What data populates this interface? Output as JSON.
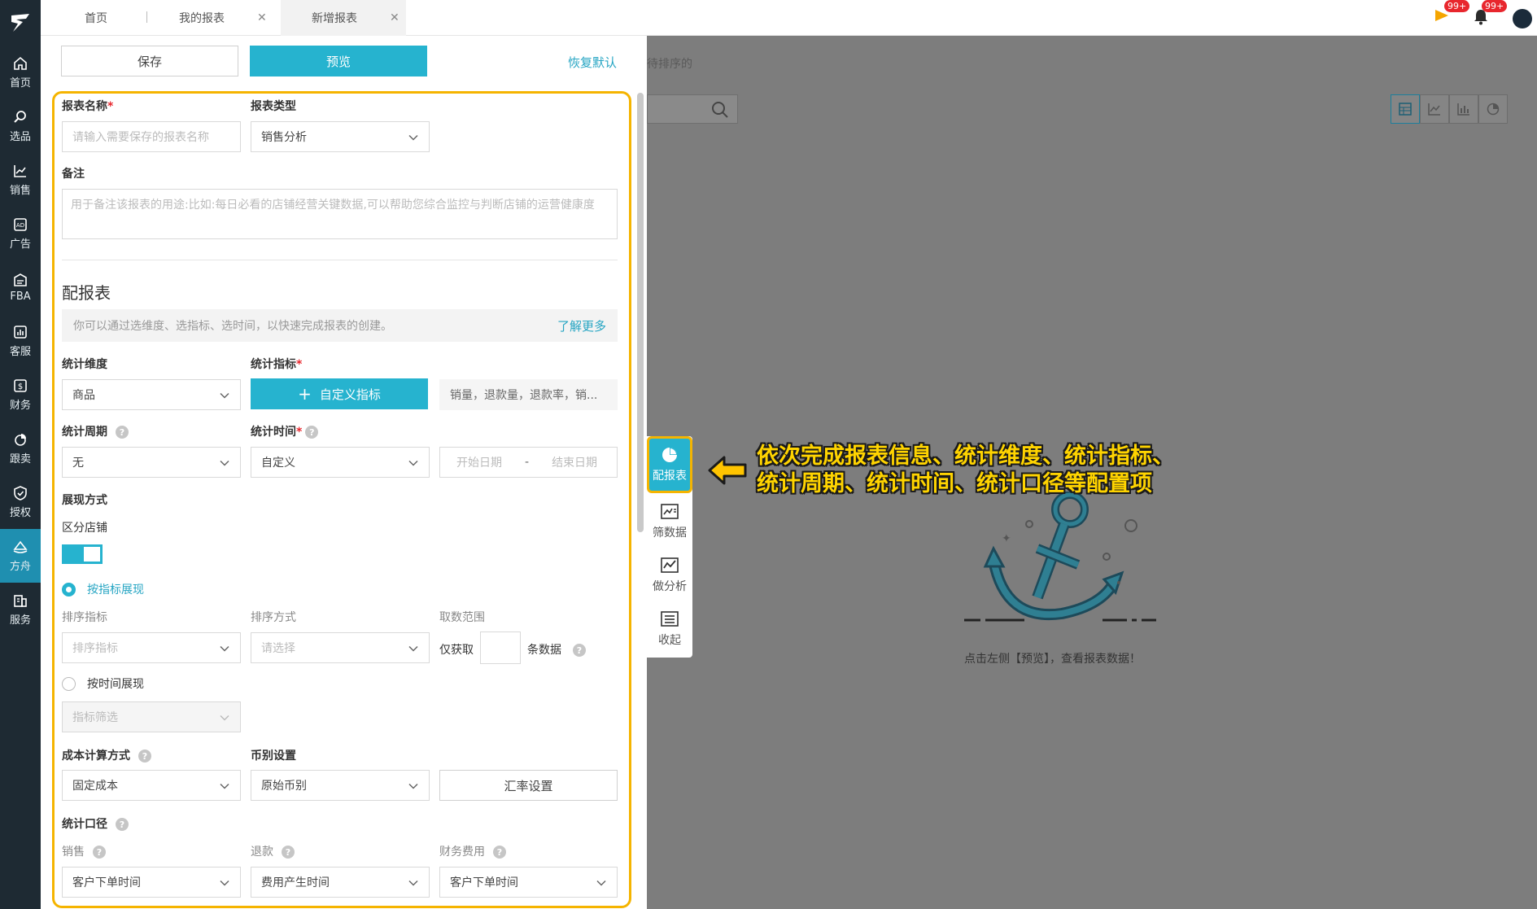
{
  "nav": {
    "items": [
      {
        "label": "首页",
        "icon": "home-icon"
      },
      {
        "label": "选品",
        "icon": "search-icon"
      },
      {
        "label": "销售",
        "icon": "chart-line-icon"
      },
      {
        "label": "广告",
        "icon": "ad-icon"
      },
      {
        "label": "FBA",
        "icon": "warehouse-icon"
      },
      {
        "label": "客服",
        "icon": "bar-chart-icon"
      },
      {
        "label": "财务",
        "icon": "dollar-icon"
      },
      {
        "label": "跟卖",
        "icon": "pie-icon"
      },
      {
        "label": "授权",
        "icon": "shield-icon"
      },
      {
        "label": "方舟",
        "icon": "ark-icon"
      },
      {
        "label": "服务",
        "icon": "building-icon"
      }
    ],
    "active": "方舟"
  },
  "tabs": [
    {
      "label": "首页"
    },
    {
      "label": "我的报表"
    },
    {
      "label": "新增报表"
    }
  ],
  "notifications": {
    "flag_count": "99+",
    "bell_count": "99+"
  },
  "toolbar": {
    "save": "保存",
    "preview": "预览",
    "reset": "恢复默认"
  },
  "background": {
    "sort_text": "待排序的",
    "empty_text": "点击左侧【预览】，查看报表数据！"
  },
  "form": {
    "report_name_label": "报表名称",
    "report_name_placeholder": "请输入需要保存的报表名称",
    "report_type_label": "报表类型",
    "report_type_value": "销售分析",
    "remark_label": "备注",
    "remark_placeholder": "用于备注该报表的用途:比如:每日必看的店铺经营关键数据,可以帮助您综合监控与判断店铺的运营健康度",
    "section_title": "配报表",
    "hint_text": "你可以通过选维度、选指标、选时间，以快速完成报表的创建。",
    "hint_more": "了解更多",
    "dimension_label": "统计维度",
    "dimension_value": "商品",
    "metric_label": "统计指标",
    "custom_metric_button": "自定义指标",
    "metric_summary": "销量，退款量，退款率，销...",
    "period_label": "统计周期",
    "period_value": "无",
    "time_label": "统计时间",
    "time_value": "自定义",
    "start_date": "开始日期",
    "date_sep": "-",
    "end_date": "结束日期",
    "display_label": "展现方式",
    "shop_split_label": "区分店铺",
    "by_metric_label": "按指标展现",
    "sort_metric_label": "排序指标",
    "sort_metric_placeholder": "排序指标",
    "sort_method_label": "排序方式",
    "sort_method_placeholder": "请选择",
    "range_label": "取数范围",
    "range_prefix": "仅获取",
    "range_suffix": "条数据",
    "by_time_label": "按时间展现",
    "metric_filter_placeholder": "指标筛选",
    "cost_label": "成本计算方式",
    "cost_value": "固定成本",
    "currency_label": "币别设置",
    "currency_value": "原始币别",
    "rate_button": "汇率设置",
    "caliber_label": "统计口径",
    "sales_label": "销售",
    "sales_value": "客户下单时间",
    "refund_label": "退款",
    "refund_value": "费用产生时间",
    "finance_label": "财务费用",
    "finance_value": "客户下单时间"
  },
  "side_tool": [
    {
      "label": "配报表",
      "icon": "pie-icon"
    },
    {
      "label": "筛数据",
      "icon": "filter-chart-icon"
    },
    {
      "label": "做分析",
      "icon": "line-chart-icon"
    },
    {
      "label": "收起",
      "icon": "list-icon"
    }
  ],
  "annotation": {
    "line1": "依次完成报表信息、统计维度、统计指标、",
    "line2": "统计周期、统计时间、统计口径等配置项"
  },
  "colors": {
    "accent": "#26b3cf",
    "highlight": "#f5b400",
    "nav_bg": "#1e2a33"
  }
}
